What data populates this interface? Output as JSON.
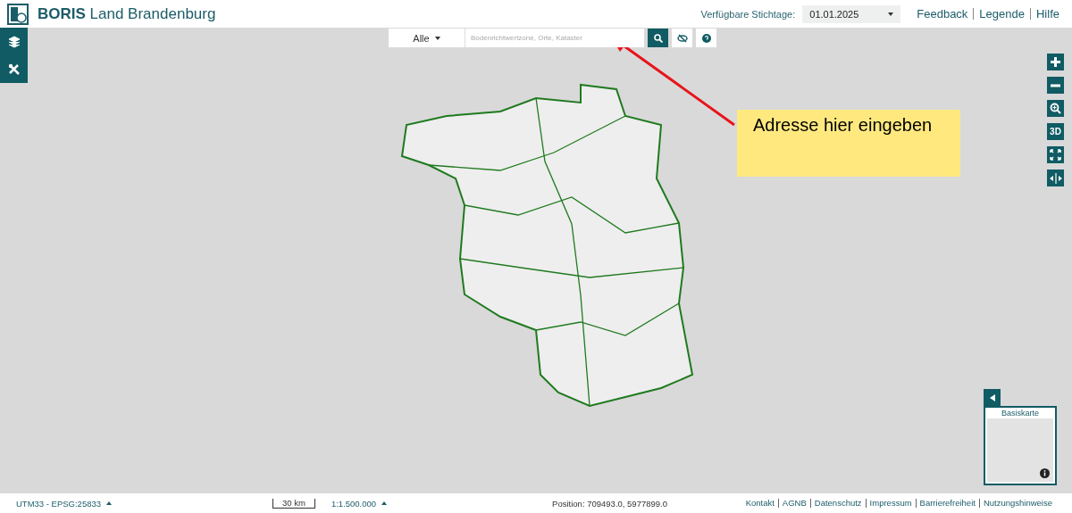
{
  "header": {
    "title": "**BORIS** Land Brandenburg",
    "date_label": "Verfügbare Stichtage:",
    "date_value": "01.01.2025",
    "links": [
      "Feedback",
      "Legende",
      "Hilfe"
    ]
  },
  "search": {
    "filter": "Alle",
    "placeholder": "Bodenrichtwertzone, Orte, Kataster"
  },
  "map_controls": {
    "three_d": "3D"
  },
  "annotation": {
    "text": "Adresse hier eingeben"
  },
  "minimap": {
    "title": "Basiskarte"
  },
  "footer": {
    "projection": "UTM33 - EPSG:25833",
    "scale_bar": "30 km",
    "scale": "1:1.500.000",
    "position": "Position: 709493.0, 5977899.0",
    "links": [
      "Kontakt",
      "AGNB",
      "Datenschutz",
      "Impressum",
      "Barrierefreiheit",
      "Nutzungshinweise"
    ]
  }
}
